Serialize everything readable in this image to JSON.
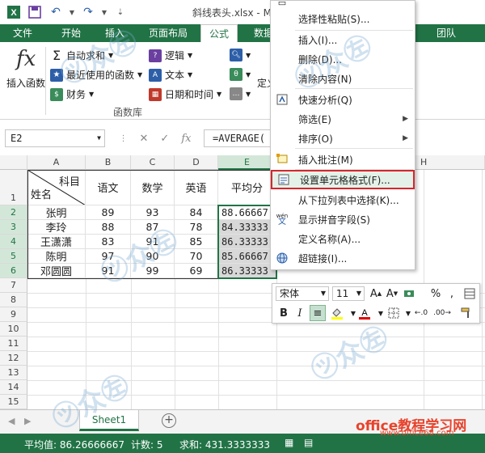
{
  "window": {
    "title": "斜线表头.xlsx - Micros"
  },
  "ribbon_tabs": [
    "文件",
    "开始",
    "插入",
    "页面布局",
    "公式",
    "数据",
    "团队"
  ],
  "ribbon": {
    "insert_function": "插入函数",
    "autosum": "自动求和",
    "recent": "最近使用的函数",
    "finance": "财务",
    "logic": "逻辑",
    "text": "文本",
    "datetime": "日期和时间",
    "define_partial": "定义",
    "group_label": "函数库"
  },
  "formula_bar": {
    "name_box": "E2",
    "formula": "=AVERAGE("
  },
  "grid": {
    "columns": [
      "A",
      "B",
      "C",
      "D",
      "E",
      "H"
    ],
    "row_numbers": [
      "1",
      "2",
      "3",
      "4",
      "5",
      "6",
      "7",
      "8",
      "9",
      "10",
      "11",
      "12",
      "13",
      "14",
      "15"
    ],
    "header_top": "科目",
    "header_bottom": "姓名",
    "headers": [
      "语文",
      "数学",
      "英语",
      "平均分"
    ],
    "rows": [
      [
        "张明",
        "89",
        "93",
        "84",
        "88.66667"
      ],
      [
        "李玲",
        "88",
        "87",
        "78",
        "84.33333"
      ],
      [
        "王潇潇",
        "83",
        "91",
        "85",
        "86.33333"
      ],
      [
        "陈明",
        "97",
        "90",
        "70",
        "85.66667"
      ],
      [
        "邓圆圆",
        "91",
        "99",
        "69",
        "86.33333"
      ]
    ]
  },
  "context_menu": {
    "paste_special": "选择性粘贴(S)...",
    "insert": "插入(I)...",
    "delete": "删除(D)...",
    "clear": "清除内容(N)",
    "quick_analysis": "快速分析(Q)",
    "filter": "筛选(E)",
    "sort": "排序(O)",
    "insert_comment": "插入批注(M)",
    "format_cells": "设置单元格格式(F)...",
    "pick_list": "从下拉列表中选择(K)...",
    "phonetic": "显示拼音字段(S)",
    "define_name": "定义名称(A)...",
    "hyperlink": "超链接(I)...",
    "phonetic_icon_text": "wén"
  },
  "mini_toolbar": {
    "font": "宋体",
    "size": "11"
  },
  "sheet_tab": "Sheet1",
  "status": {
    "average": "平均值: 86.26666667",
    "count": "计数: 5",
    "sum": "求和: 431.3333333"
  },
  "watermark": {
    "site": "office教程学习网",
    "url": "www.office68.com"
  },
  "colors": {
    "excel_green": "#217346",
    "highlight_border": "#d6262c",
    "selection_gray": "#d8d8d8"
  }
}
